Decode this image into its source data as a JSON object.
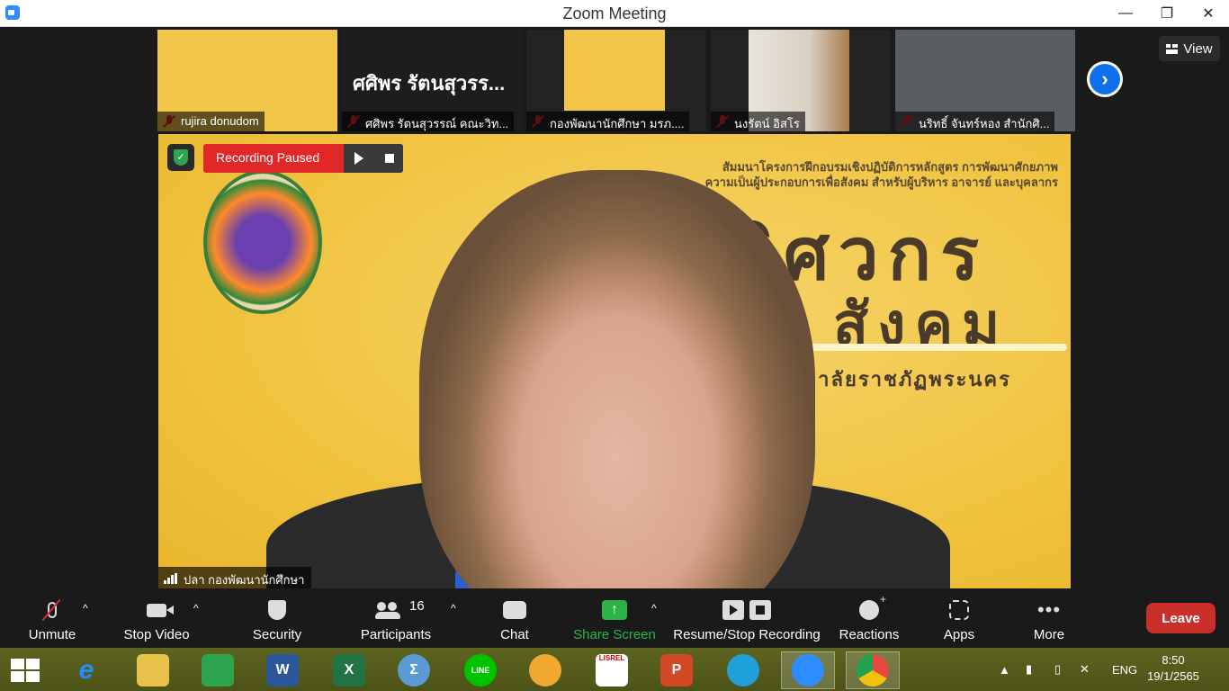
{
  "window": {
    "title": "Zoom Meeting",
    "minimize": "—",
    "maximize": "❐",
    "close": "✕"
  },
  "gallery": {
    "view_label": "View",
    "next_arrow": "›",
    "tiles": [
      {
        "name": "rujira donudom"
      },
      {
        "name": "ศศิพร รัตนสุวรรณ์ คณะวิท...",
        "big_name": "ศศิพร รัตนสุวรร..."
      },
      {
        "name": "กองพัฒนานักศึกษา มรภ...."
      },
      {
        "name": "นงรัตน์ อิสโร"
      },
      {
        "name": "นริทธิ์ จันทร์หอง สำนักศิ..."
      }
    ]
  },
  "main": {
    "speaker_name": "ปลา กองพัฒนานักศึกษา",
    "recording_status": "Recording Paused",
    "background_blurb": "สัมมนาโครงการฝึกอบรมเชิงปฏิบัติการหลักสูตร การพัฒนาศักยภาพความเป็นผู้ประกอบการเพื่อสังคม สำหรับผู้บริหาร อาจารย์ และบุคลากร",
    "background_title_line1": "วิศวกร",
    "background_title_line2": "สังคม",
    "background_subtitle": "มหาวิทยาลัยราชภัฏพระนคร"
  },
  "toolbar": {
    "unmute": "Unmute",
    "stop_video": "Stop Video",
    "security": "Security",
    "participants": "Participants",
    "participants_count": "16",
    "chat": "Chat",
    "share_screen": "Share Screen",
    "resume_stop_recording": "Resume/Stop Recording",
    "reactions": "Reactions",
    "apps": "Apps",
    "more": "More",
    "more_glyph": "•••",
    "leave": "Leave",
    "caret": "^",
    "share_arrow": "↑",
    "colors": {
      "leave": "#c9302c",
      "share": "#2bb34a",
      "recording": "#e02828"
    }
  },
  "taskbar": {
    "apps": [
      {
        "name": "internet-explorer",
        "glyph": "e",
        "color": "#1e90ff"
      },
      {
        "name": "file-explorer",
        "glyph": "",
        "color": "#e8c14a"
      },
      {
        "name": "store",
        "glyph": "",
        "color": "#2ea44f"
      },
      {
        "name": "word",
        "glyph": "W",
        "color": "#2b579a"
      },
      {
        "name": "excel",
        "glyph": "X",
        "color": "#217346"
      },
      {
        "name": "calculator",
        "glyph": "Σ",
        "color": "#5b9bd5"
      },
      {
        "name": "line",
        "glyph": "LINE",
        "color": "#00c300"
      },
      {
        "name": "paint",
        "glyph": "",
        "color": "#f0a830"
      },
      {
        "name": "lisrel",
        "glyph": "LISREL",
        "color": "#ffffff"
      },
      {
        "name": "powerpoint",
        "glyph": "P",
        "color": "#d24726"
      },
      {
        "name": "edge",
        "glyph": "",
        "color": "#1fa0d8"
      },
      {
        "name": "zoom",
        "glyph": "",
        "color": "#2d8cff"
      },
      {
        "name": "chrome",
        "glyph": "",
        "color": "#e54b3c"
      }
    ],
    "language": "ENG",
    "tray_expand": "▲",
    "time": "8:50",
    "date": "19/1/2565"
  }
}
